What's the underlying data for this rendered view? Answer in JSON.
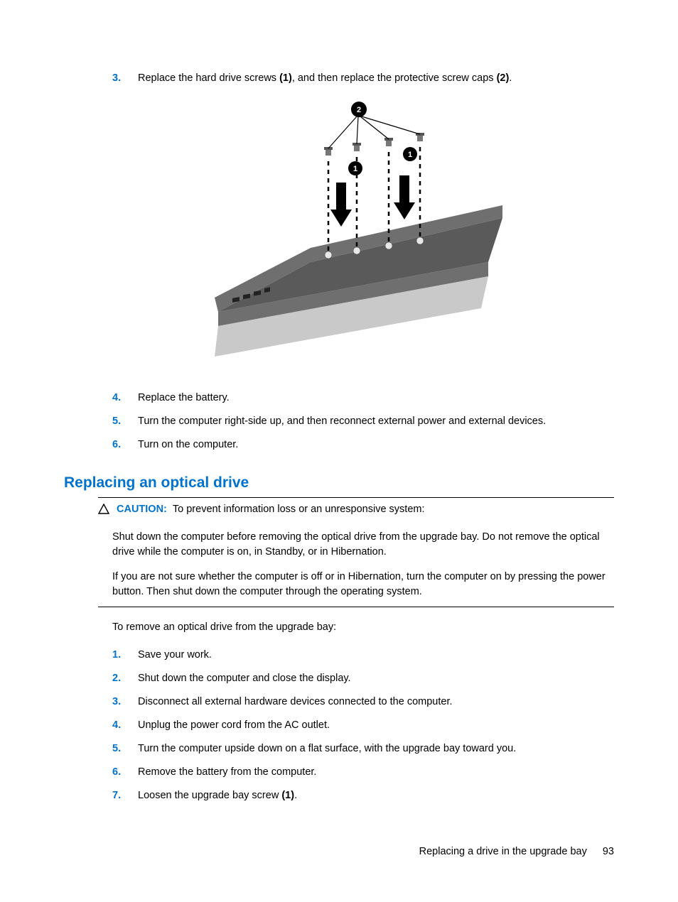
{
  "steps_top": {
    "item3_num": "3.",
    "item3_a": "Replace the hard drive screws ",
    "item3_b": "(1)",
    "item3_c": ", and then replace the protective screw caps ",
    "item3_d": "(2)",
    "item3_e": ".",
    "item4_num": "4.",
    "item4_text": "Replace the battery.",
    "item5_num": "5.",
    "item5_text": "Turn the computer right-side up, and then reconnect external power and external devices.",
    "item6_num": "6.",
    "item6_text": "Turn on the computer."
  },
  "heading": "Replacing an optical drive",
  "caution": {
    "label": "CAUTION:",
    "first": "To prevent information loss or an unresponsive system:",
    "p1": "Shut down the computer before removing the optical drive from the upgrade bay. Do not remove the optical drive while the computer is on, in Standby, or in Hibernation.",
    "p2": "If you are not sure whether the computer is off or in Hibernation, turn the computer on by pressing the power button. Then shut down the computer through the operating system."
  },
  "intro": "To remove an optical drive from the upgrade bay:",
  "steps_bottom": {
    "s1_num": "1.",
    "s1_text": "Save your work.",
    "s2_num": "2.",
    "s2_text": "Shut down the computer and close the display.",
    "s3_num": "3.",
    "s3_text": "Disconnect all external hardware devices connected to the computer.",
    "s4_num": "4.",
    "s4_text": "Unplug the power cord from the AC outlet.",
    "s5_num": "5.",
    "s5_text": "Turn the computer upside down on a flat surface, with the upgrade bay toward you.",
    "s6_num": "6.",
    "s6_text": "Remove the battery from the computer.",
    "s7_num": "7.",
    "s7_a": "Loosen the upgrade bay screw ",
    "s7_b": "(1)",
    "s7_c": "."
  },
  "footer": {
    "title": "Replacing a drive in the upgrade bay",
    "page": "93"
  },
  "illustration": {
    "callout1": "1",
    "callout2": "2"
  }
}
